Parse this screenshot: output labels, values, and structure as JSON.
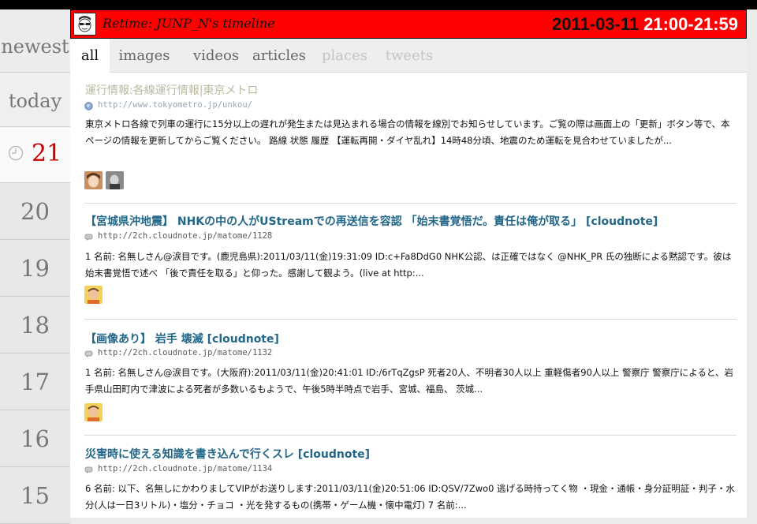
{
  "rail": {
    "newest": "newest",
    "today": "today",
    "current_hour": "21",
    "hours": [
      "20",
      "19",
      "18",
      "17",
      "16",
      "15"
    ]
  },
  "header": {
    "title": "Retime: JUNP_N's timeline",
    "date": "2011-03-11",
    "time_range": "21:00-21:59"
  },
  "tabs": [
    {
      "label": "all",
      "state": "active"
    },
    {
      "label": "images",
      "state": "normal"
    },
    {
      "label": "videos",
      "state": "normal"
    },
    {
      "label": "articles",
      "state": "normal"
    },
    {
      "label": "places",
      "state": "disabled"
    },
    {
      "label": "tweets",
      "state": "disabled"
    }
  ],
  "entries": [
    {
      "title": "運行情報:各線運行情報|東京メトロ",
      "url": "http://www.tokyometro.jp/unkou/",
      "desc": "東京メトロ各線で列車の運行に15分以上の遅れが発生または見込まれる場合の情報を線別でお知らせしています。ご覧の際は画面上の「更新」ボタン等で、本ページの情報を更新してからご覧ください。 路線 状態 履歴 【運転再開・ダイヤ乱れ】14時48分頃、地震のため運転を見合わせていましたが..."
    },
    {
      "title": "【宮城県沖地震】 NHKの中の人がUStreamでの再送信を容認 「始末書覚悟だ。責任は俺が取る」 [cloudnote]",
      "url": "http://2ch.cloudnote.jp/matome/1128",
      "desc": "1 名前: 名無しさん@涙目です。(鹿児島県):2011/03/11(金)19:31:09 ID:c+Fa8DdG0 NHK公認、は正確ではなく @NHK_PR 氏の独断による黙認です。彼は始末書覚悟で述べ 「後で責任を取る」と仰った。感謝して観よう。(live at http:..."
    },
    {
      "title": "【画像あり】 岩手 壊滅 [cloudnote]",
      "url": "http://2ch.cloudnote.jp/matome/1132",
      "desc": "1 名前: 名無しさん@涙目です。(大阪府):2011/03/11(金)20:41:01 ID:/6rTqZgsP 死者20人、不明者30人以上 重軽傷者90人以上 警察庁 警察庁によると、岩手県山田町内で津波による死者が多数いるもようで、午後5時半時点で岩手、宮城、福島、 茨城..."
    },
    {
      "title": "災害時に使える知識を書き込んで行くスレ [cloudnote]",
      "url": "http://2ch.cloudnote.jp/matome/1134",
      "desc": "6 名前: 以下、名無しにかわりましてVIPがお送りします:2011/03/11(金)20:51:06 ID:QSV/7Zwo0 逃げる時持ってく物 ・現金・通帳・身分証明証・判子・水分(人は一日3リトル)・塩分・チョコ ・光を発するもの(携帯・ゲーム機・懐中電灯) 7 名前:..."
    }
  ]
}
